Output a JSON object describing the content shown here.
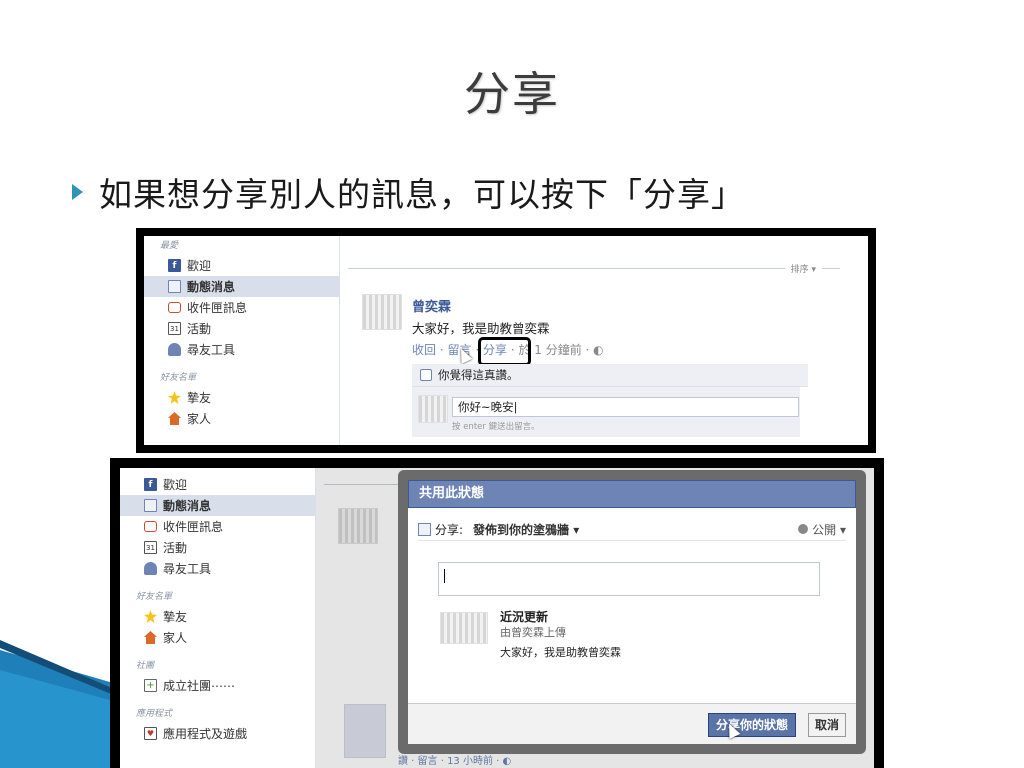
{
  "slide": {
    "title": "分享",
    "bullet": "如果想分享別人的訊息，可以按下「分享」"
  },
  "shot1": {
    "sidebar": {
      "top_partial": "最愛",
      "items": [
        {
          "label": "歡迎",
          "icon": "facebook-icon"
        },
        {
          "label": "動態消息",
          "icon": "news-feed-icon",
          "active": true
        },
        {
          "label": "收件匣訊息",
          "icon": "messages-icon"
        },
        {
          "label": "活動",
          "icon": "calendar-icon",
          "badge": "31"
        },
        {
          "label": "尋友工具",
          "icon": "find-friends-icon"
        }
      ],
      "section_friends": "好友名單",
      "friend_lists": [
        {
          "label": "摯友",
          "icon": "star-icon"
        },
        {
          "label": "家人",
          "icon": "home-icon"
        }
      ]
    },
    "feed": {
      "sort_label": "排序 ▾",
      "post": {
        "author": "曾奕霖",
        "text": "大家好，我是助教曾奕霖",
        "actions": {
          "retract": "收回",
          "comment": "留言",
          "share": "分享",
          "time": "於 1 分鐘前 · ◐"
        },
        "like_text": "你覺得這真讚。",
        "comment_value": "你好~晚安|",
        "comment_hint": "按 enter 鍵送出留言。"
      }
    }
  },
  "shot2": {
    "sidebar": {
      "items": [
        {
          "label": "歡迎",
          "icon": "facebook-icon"
        },
        {
          "label": "動態消息",
          "icon": "news-feed-icon",
          "active": true
        },
        {
          "label": "收件匣訊息",
          "icon": "messages-icon"
        },
        {
          "label": "活動",
          "icon": "calendar-icon",
          "badge": "31"
        },
        {
          "label": "尋友工具",
          "icon": "find-friends-icon"
        }
      ],
      "section_friends": "好友名單",
      "friend_lists": [
        {
          "label": "摯友",
          "icon": "star-icon"
        },
        {
          "label": "家人",
          "icon": "home-icon"
        }
      ],
      "section_groups": "社團",
      "groups": [
        {
          "label": "成立社團⋯⋯",
          "icon": "create-group-icon"
        }
      ],
      "section_apps": "應用程式",
      "apps": [
        {
          "label": "應用程式及遊戲",
          "icon": "apps-icon"
        }
      ]
    },
    "dialog": {
      "title": "共用此狀態",
      "share_prefix": "分享:",
      "share_target": "發佈到你的塗鴉牆 ▾",
      "privacy": "公開 ▾",
      "preview_title": "近況更新",
      "preview_sub": "由曾奕霖上傳",
      "preview_text": "大家好，我是助教曾奕霖",
      "share_button": "分享你的狀態",
      "cancel_button": "取消"
    },
    "behind": {
      "post2_actions": "讚 · 留言 · 13 小時前 · ◐"
    }
  },
  "colors": {
    "fb_blue": "#3b5998",
    "fb_dialog_head": "#6d84b4",
    "bullet_accent": "#2f93b8"
  }
}
